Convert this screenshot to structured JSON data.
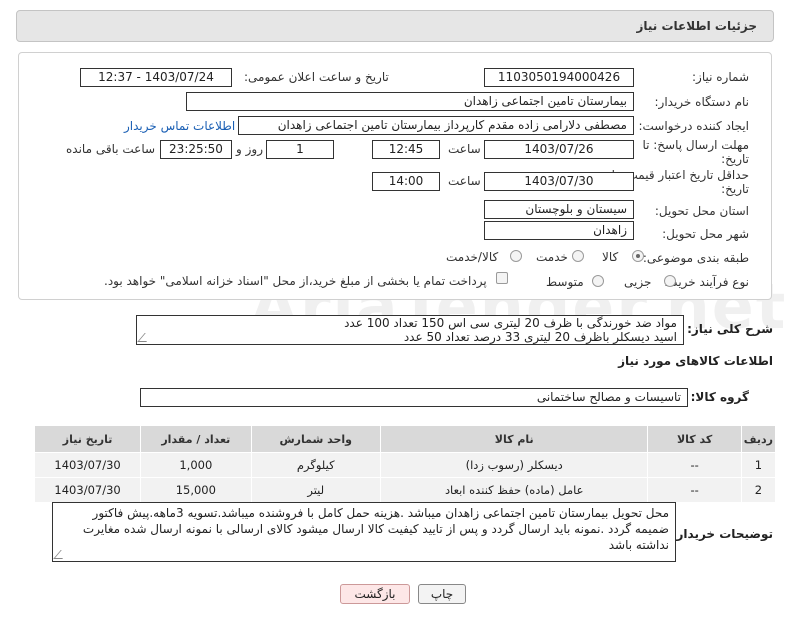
{
  "header": {
    "title": "جزئیات اطلاعات نیاز"
  },
  "fields": {
    "need_number": {
      "label": "شماره نیاز:",
      "value": "1103050194000426"
    },
    "announce": {
      "label": "تاریخ و ساعت اعلان عمومی:",
      "value": "1403/07/24 - 12:37"
    },
    "buyer_org": {
      "label": "نام دستگاه خریدار:",
      "value": "بیمارستان تامین اجتماعی زاهدان"
    },
    "creator": {
      "label": "ایجاد کننده درخواست:",
      "value": "مصطفی دلارامی زاده مقدم کارپرداز بیمارستان تامین اجتماعی زاهدان",
      "contact_link": "اطلاعات تماس خریدار"
    },
    "reply_deadline": {
      "label_line1": "مهلت ارسال پاسخ: تا",
      "label_line2": "تاریخ:",
      "date": "1403/07/26",
      "time_label": "ساعت",
      "time": "12:45",
      "days": "1",
      "days_label": "روز و",
      "remaining": "23:25:50",
      "remaining_label": "ساعت باقی مانده"
    },
    "price_validity": {
      "label_line1": "حداقل تاریخ اعتبار قیمت: تا",
      "label_line2": "تاریخ:",
      "date": "1403/07/30",
      "time_label": "ساعت",
      "time": "14:00"
    },
    "province": {
      "label": "استان محل تحویل:",
      "value": "سیستان و بلوچستان"
    },
    "city": {
      "label": "شهر محل تحویل:",
      "value": "زاهدان"
    },
    "category": {
      "label": "طبقه بندی موضوعی:",
      "options": [
        "کالا",
        "خدمت",
        "کالا/خدمت"
      ],
      "selected": "کالا"
    },
    "process": {
      "label": "نوع فرآیند خرید :",
      "options": [
        "جزیی",
        "متوسط"
      ],
      "payment_note": "پرداخت تمام یا بخشی از مبلغ خرید،از محل \"اسناد خزانه اسلامی\" خواهد بود."
    }
  },
  "summary": {
    "label": "شرح کلی نیاز:",
    "line1": "مواد ضد خورندگی با ظرف 20 لیتری سی اس 150 تعداد 100 عدد",
    "line2": "اسید دیسکلر باظرف 20 لیتری 33 درصد تعداد 50 عدد"
  },
  "goods_info_title": "اطلاعات کالاهای مورد نیاز",
  "goods_group": {
    "label": "گروه کالا:",
    "value": "تاسیسات و مصالح ساختمانی"
  },
  "table": {
    "headers": [
      "ردیف",
      "کد کالا",
      "نام کالا",
      "واحد شمارش",
      "تعداد / مقدار",
      "تاریخ نیاز"
    ],
    "rows": [
      [
        "1",
        "--",
        "دیسکلر (رسوب زدا)",
        "کیلوگرم",
        "1,000",
        "1403/07/30"
      ],
      [
        "2",
        "--",
        "عامل (ماده) حفظ کننده ابعاد",
        "لیتر",
        "15,000",
        "1403/07/30"
      ]
    ]
  },
  "buyer_notes": {
    "label": "توضیحات خریدار:",
    "line1": "محل تحویل بیمارستان تامین اجتماعی زاهدان میباشد .هزینه حمل کامل با فروشنده میباشد.تسویه 3ماهه.پیش فاکتور",
    "line2": "ضمیمه گردد .نمونه باید ارسال گردد و پس از تایید کیفیت کالا ارسال میشود کالای ارسالی با نمونه ارسال شده مغایرت",
    "line3": "نداشته باشد"
  },
  "buttons": {
    "print": "چاپ",
    "back": "بازگشت"
  },
  "watermark": "AriaTender.net",
  "colors": {
    "link": "#1a5fb4",
    "back_button_bg": "#fde7e7",
    "table_header": "#d9d9d9"
  }
}
